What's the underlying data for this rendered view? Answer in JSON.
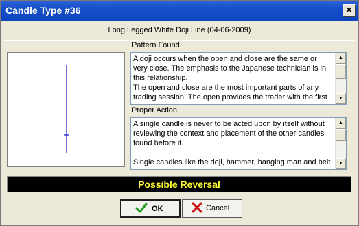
{
  "window": {
    "title": "Candle Type #36",
    "close_glyph": "×"
  },
  "pattern_title": "Long Legged White Doji Line (04-06-2009)",
  "pattern_found": {
    "label": "Pattern Found",
    "text": "A doji occurs when the open and close are the same or very close. The emphasis to the Japanese technician is in this relationship.\nThe open and close are the most important parts of any trading session. The open provides the trader with the first"
  },
  "proper_action": {
    "label": "Proper Action",
    "text": "A single candle is never to be acted upon by itself without reviewing the context and placement of the other candles found before it.\n\nSingle candles like the doji, hammer, hanging man and belt"
  },
  "signal": {
    "text": "Possible Reversal",
    "color": "#ffff33"
  },
  "buttons": {
    "ok_label": "OK",
    "cancel_label": "Cancel",
    "ok_icon": "check-icon",
    "cancel_icon": "x-icon"
  },
  "colors": {
    "candle": "#1010c0",
    "title_bar": "#1650c9",
    "banner_bg": "#000000"
  }
}
